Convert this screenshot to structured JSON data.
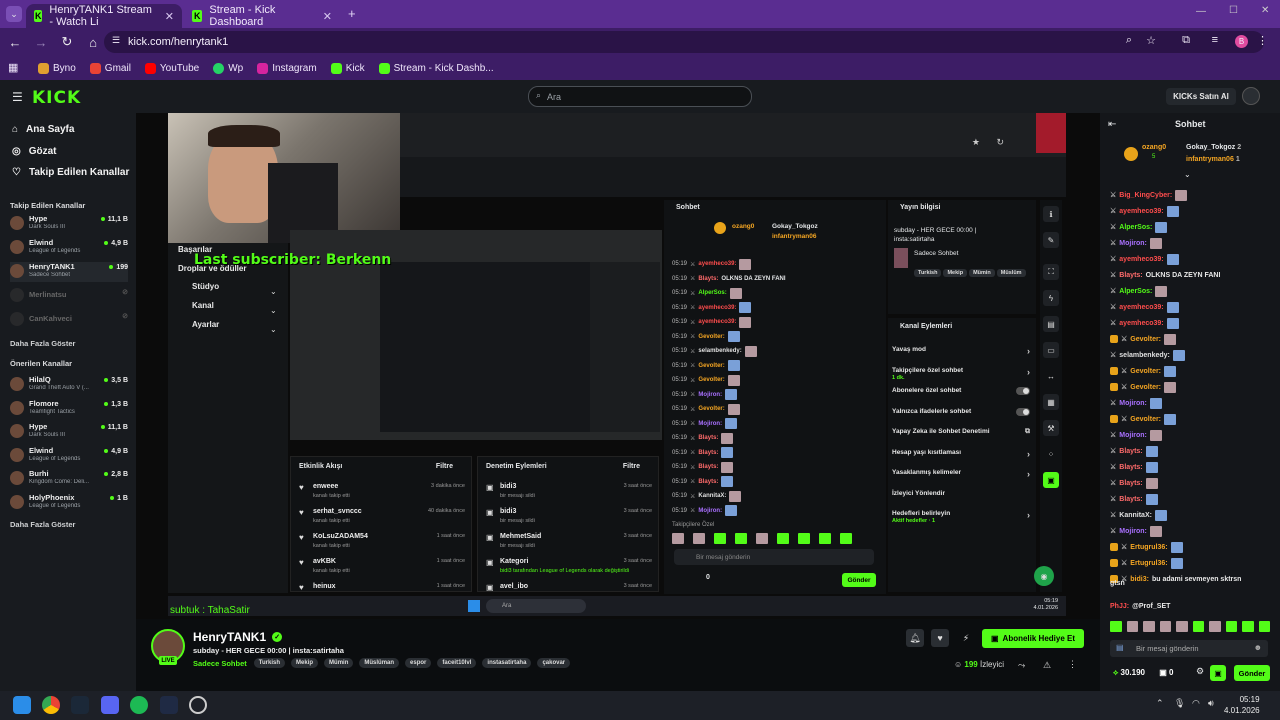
{
  "browser": {
    "tabs": [
      {
        "label": "HenryTANK1 Stream - Watch Li"
      },
      {
        "label": "Stream - Kick Dashboard"
      }
    ],
    "url": "kick.com/henrytank1",
    "bookmarks": [
      "Byno",
      "Gmail",
      "YouTube",
      "Wp",
      "Instagram",
      "Kick",
      "Stream - Kick Dashb..."
    ]
  },
  "header": {
    "logo": "KICK",
    "search_placeholder": "Ara",
    "ai_button": "KICKs Satın Al"
  },
  "sidebar": {
    "nav": [
      "Ana Sayfa",
      "Gözat",
      "Takip Edilen Kanallar"
    ],
    "followed_title": "Takip Edilen Kanallar",
    "followed": [
      {
        "name": "Hype",
        "game": "Dark Souls III",
        "viewers": "11,1 B"
      },
      {
        "name": "Elwind",
        "game": "League of Legends",
        "viewers": "4,9 B"
      },
      {
        "name": "HenryTANK1",
        "game": "Sadece Sohbet",
        "viewers": "199"
      },
      {
        "name": "Merlinatsu",
        "game": "",
        "viewers": ""
      },
      {
        "name": "CanKahveci",
        "game": "",
        "viewers": ""
      }
    ],
    "show_more": "Daha Fazla Göster",
    "recommended_title": "Önerilen Kanallar",
    "recommended": [
      {
        "name": "HilalQ",
        "game": "Grand Theft Auto V (...",
        "viewers": "3,5 B"
      },
      {
        "name": "Flomore",
        "game": "Teamfight Tactics",
        "viewers": "1,3 B"
      },
      {
        "name": "Hype",
        "game": "Dark Souls III",
        "viewers": "11,1 B"
      },
      {
        "name": "Elwind",
        "game": "League of Legends",
        "viewers": "4,9 B"
      },
      {
        "name": "Burhi",
        "game": "Kingdom Come: Deli...",
        "viewers": "2,8 B"
      },
      {
        "name": "HolyPhoenix",
        "game": "League of Legends",
        "viewers": "1 B"
      }
    ],
    "show_more2": "Daha Fazla Göster"
  },
  "stream": {
    "inner_nav": [
      "Başarılar",
      "Droplar ve ödüller",
      "Stüdyo",
      "Kanal",
      "Ayarlar"
    ],
    "overlay_text": "Last subscriber: Berkenn",
    "sub_ticker": "subtuk : TahaSatir",
    "activity": {
      "title": "Etkinlik Akışı",
      "filter": "Filtre",
      "rows": [
        {
          "user": "enweee",
          "sub": "kanalı takip etti",
          "time": "3 dakika önce"
        },
        {
          "user": "serhat_svnccc",
          "sub": "kanalı takip etti",
          "time": "40 dakika önce"
        },
        {
          "user": "KoLsuZADAM54",
          "sub": "kanalı takip etti",
          "time": "1 saat önce"
        },
        {
          "user": "avKBK",
          "sub": "kanalı takip etti",
          "time": "1 saat önce"
        },
        {
          "user": "heinux",
          "sub": "",
          "time": "1 saat önce"
        }
      ]
    },
    "moderation": {
      "title": "Denetim Eylemleri",
      "filter": "Filtre",
      "rows": [
        {
          "user": "bidi3",
          "sub": "bir mesajı sildi",
          "time": "3 saat önce"
        },
        {
          "user": "bidi3",
          "sub": "bir mesajı sildi",
          "time": "3 saat önce"
        },
        {
          "user": "MehmetSaid",
          "sub": "bir mesajı sildi",
          "time": "3 saat önce"
        },
        {
          "user": "Kategori",
          "sub": "bidi3 tarafından League of Legends olarak değiştirildi",
          "time": "3 saat önce"
        },
        {
          "user": "avel_ibo",
          "sub": "",
          "time": "3 saat önce"
        }
      ]
    },
    "midchat": {
      "title": "Sohbet",
      "top1": "ozang0",
      "top2": "Gokay_Tokgoz",
      "top3": "infantryman06",
      "lines": [
        {
          "time": "05:19",
          "user": "ayemheco39:",
          "color": "#ff4d4d",
          "text": ""
        },
        {
          "time": "05:19",
          "user": "Blayts:",
          "color": "#ff6b6b",
          "text": "OLKNS DA ZEYN FANI"
        },
        {
          "time": "05:19",
          "user": "AlperSos:",
          "color": "#53fc18",
          "text": ""
        },
        {
          "time": "05:19",
          "user": "ayemheco39:",
          "color": "#ff4d4d",
          "text": ""
        },
        {
          "time": "05:19",
          "user": "ayemheco39:",
          "color": "#ff4d4d",
          "text": ""
        },
        {
          "time": "05:19",
          "user": "Gevolter:",
          "color": "#f5a623",
          "text": ""
        },
        {
          "time": "05:19",
          "user": "selambenkedy:",
          "color": "#e0e0e0",
          "text": ""
        },
        {
          "time": "05:19",
          "user": "Gevolter:",
          "color": "#f5a623",
          "text": ""
        },
        {
          "time": "05:19",
          "user": "Gevolter:",
          "color": "#f5a623",
          "text": ""
        },
        {
          "time": "05:19",
          "user": "Mojiron:",
          "color": "#a970ff",
          "text": ""
        },
        {
          "time": "05:19",
          "user": "Gevolter:",
          "color": "#f5a623",
          "text": ""
        },
        {
          "time": "05:19",
          "user": "Mojiron:",
          "color": "#a970ff",
          "text": ""
        },
        {
          "time": "05:19",
          "user": "Blayts:",
          "color": "#ff6b6b",
          "text": ""
        },
        {
          "time": "05:19",
          "user": "Blayts:",
          "color": "#ff6b6b",
          "text": ""
        },
        {
          "time": "05:19",
          "user": "Blayts:",
          "color": "#ff6b6b",
          "text": ""
        },
        {
          "time": "05:19",
          "user": "Blayts:",
          "color": "#ff6b6b",
          "text": ""
        },
        {
          "time": "05:19",
          "user": "KannitaX:",
          "color": "#e0e0e0",
          "text": ""
        },
        {
          "time": "05:19",
          "user": "Mojiron:",
          "color": "#a970ff",
          "text": ""
        }
      ],
      "followers_only": "Takipçilere Özel",
      "input": "Bir mesaj gönderin",
      "send": "Gönder",
      "count": "0"
    },
    "info": {
      "title": "Yayın bilgisi",
      "desc": "subday - HER GECE 00:00 | insta:satirtaha",
      "cat": "Sadece Sohbet",
      "tags": [
        "Turkish",
        "Mekip",
        "Mümin",
        "Müslüm"
      ]
    },
    "kanal": {
      "title": "Kanal Eylemleri",
      "rows": [
        {
          "label": "Yavaş mod",
          "sub": "",
          "type": "arrow"
        },
        {
          "label": "Takipçilere özel sohbet",
          "sub": "1 dk.",
          "type": "arrow"
        },
        {
          "label": "Abonelere özel sohbet",
          "sub": "",
          "type": "toggle"
        },
        {
          "label": "Yalnızca ifadelerle sohbet",
          "sub": "",
          "type": "toggle"
        },
        {
          "label": "Yapay Zeka ile Sohbet Denetimi",
          "sub": "",
          "type": "ext"
        },
        {
          "label": "Hesap yaşı kısıtlaması",
          "sub": "",
          "type": "arrow"
        },
        {
          "label": "Yasaklanmış kelimeler",
          "sub": "",
          "type": "arrow"
        },
        {
          "label": "İzleyici Yönlendir",
          "sub": "",
          "type": "none"
        },
        {
          "label": "Hedefleri belirleyin",
          "sub": "Aktif hedefler · 1",
          "type": "arrow"
        }
      ]
    },
    "inner_clock": {
      "time": "05:19",
      "date": "4.01.2026"
    }
  },
  "channel": {
    "name": "HenryTANK1",
    "live": "LIVE",
    "title": "subday - HER GECE 00:00 | insta:satirtaha",
    "category": "Sadece Sohbet",
    "tags": [
      "Turkish",
      "Mekip",
      "Mümin",
      "Müslüman",
      "espor",
      "faceit10lvl",
      "instasatirtaha",
      "çakovar"
    ],
    "gift_button": "Abonelik Hediye Et",
    "viewers": "199",
    "viewers_label": "İzleyici"
  },
  "chat": {
    "title": "Sohbet",
    "top1": "ozang0",
    "top1_n": "5",
    "top2": "Gokay_Tokgoz",
    "top2_n": "2",
    "top3": "infantryman06",
    "top3_n": "1",
    "lines": [
      {
        "user": "Big_KingCyber:",
        "color": "#ff4d4d",
        "text": ""
      },
      {
        "user": "ayemheco39:",
        "color": "#ff4d4d",
        "text": ""
      },
      {
        "user": "AlperSos:",
        "color": "#53fc18",
        "text": ""
      },
      {
        "user": "Mojiron:",
        "color": "#a970ff",
        "text": ""
      },
      {
        "user": "ayemheco39:",
        "color": "#ff4d4d",
        "text": ""
      },
      {
        "user": "Blayts:",
        "color": "#ff6b6b",
        "text": "OLKNS DA ZEYN FANI"
      },
      {
        "user": "AlperSos:",
        "color": "#53fc18",
        "text": ""
      },
      {
        "user": "ayemheco39:",
        "color": "#ff4d4d",
        "text": ""
      },
      {
        "user": "ayemheco39:",
        "color": "#ff4d4d",
        "text": ""
      },
      {
        "user": "Gevolter:",
        "color": "#f5a623",
        "text": ""
      },
      {
        "user": "selambenkedy:",
        "color": "#e0e0e0",
        "text": ""
      },
      {
        "user": "Gevolter:",
        "color": "#f5a623",
        "text": ""
      },
      {
        "user": "Gevolter:",
        "color": "#f5a623",
        "text": ""
      },
      {
        "user": "Mojiron:",
        "color": "#a970ff",
        "text": ""
      },
      {
        "user": "Gevolter:",
        "color": "#f5a623",
        "text": ""
      },
      {
        "user": "Mojiron:",
        "color": "#a970ff",
        "text": ""
      },
      {
        "user": "Blayts:",
        "color": "#ff6b6b",
        "text": ""
      },
      {
        "user": "Blayts:",
        "color": "#ff6b6b",
        "text": ""
      },
      {
        "user": "Blayts:",
        "color": "#ff6b6b",
        "text": ""
      },
      {
        "user": "Blayts:",
        "color": "#ff6b6b",
        "text": ""
      },
      {
        "user": "KannitaX:",
        "color": "#e0e0e0",
        "text": ""
      },
      {
        "user": "Mojiron:",
        "color": "#a970ff",
        "text": ""
      },
      {
        "user": "Ertugrul36:",
        "color": "#f5a623",
        "text": ""
      },
      {
        "user": "Ertugrul36:",
        "color": "#f5a623",
        "text": ""
      },
      {
        "user": "bidi3:",
        "color": "#f5a623",
        "text": "bu adami sevmeyen sktrsn"
      }
    ],
    "wrap_text": "gtsn",
    "reply_user": "PhJJ:",
    "reply_text": "@Prof_SET",
    "input": "Bir mesaj gönderin",
    "points": "30.190",
    "count": "0",
    "send": "Gönder"
  },
  "clock": {
    "time": "05:19",
    "date": "4.01.2026"
  },
  "colors": {
    "accent": "#53fc18",
    "browser": "#5a2d91"
  }
}
